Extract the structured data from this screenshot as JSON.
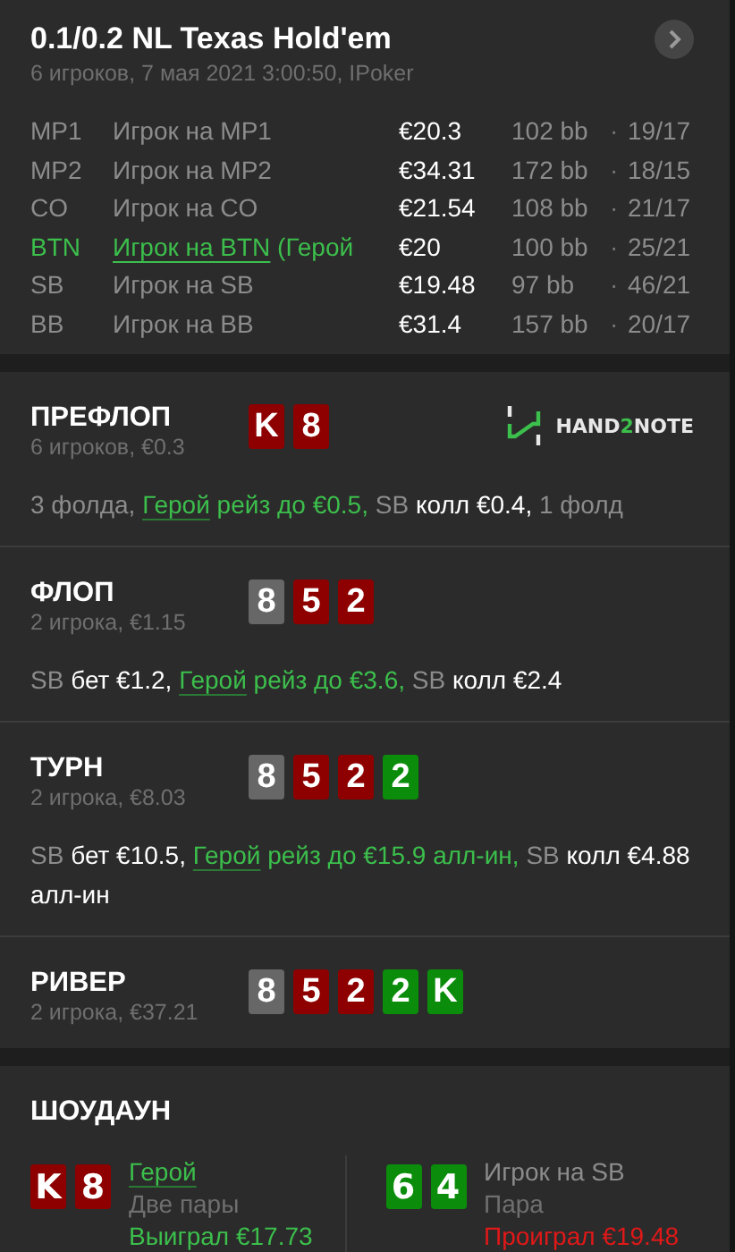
{
  "header": {
    "title": "0.1/0.2 NL Texas Hold'em",
    "subtitle": "6 игроков, 7 мая 2021 3:00:50, IPoker",
    "players": [
      {
        "position": "MP1",
        "name": "Игрок на MP1",
        "stack": "€20.3",
        "bb": "102 bb",
        "stats": "19/17",
        "hero": false
      },
      {
        "position": "MP2",
        "name": "Игрок на MP2",
        "stack": "€34.31",
        "bb": "172 bb",
        "stats": "18/15",
        "hero": false
      },
      {
        "position": "CO",
        "name": "Игрок на CO",
        "stack": "€21.54",
        "bb": "108 bb",
        "stats": "21/17",
        "hero": false
      },
      {
        "position": "BTN",
        "name": "Игрок на BTN",
        "note": "(Герой",
        "stack": "€20",
        "bb": "100 bb",
        "stats": "25/21",
        "hero": true
      },
      {
        "position": "SB",
        "name": "Игрок на SB",
        "stack": "€19.48",
        "bb": "97 bb",
        "stats": "46/21",
        "hero": false
      },
      {
        "position": "BB",
        "name": "Игрок на BB",
        "stack": "€31.4",
        "bb": "157 bb",
        "stats": "20/17",
        "hero": false
      }
    ],
    "separator": "·"
  },
  "streets": [
    {
      "title": "ПРЕФЛОП",
      "subtitle": "6 игроков, €0.3",
      "cards": [
        {
          "rank": "K",
          "color": "#8e0000"
        },
        {
          "rank": "8",
          "color": "#8e0000"
        }
      ],
      "logo": {
        "before": "HAND",
        "accent": "2",
        "after": "NOTE"
      },
      "actions": [
        {
          "text": "3 фолда, ",
          "kind": "muted"
        },
        {
          "text": "Герой",
          "kind": "hero-link"
        },
        {
          "text": " рейз до €0.5, ",
          "kind": "hero"
        },
        {
          "text": "SB",
          "kind": "muted"
        },
        {
          "text": " колл €0.4, ",
          "kind": "plain"
        },
        {
          "text": "1 фолд",
          "kind": "muted"
        }
      ]
    },
    {
      "title": "ФЛОП",
      "subtitle": "2 игрока, €1.15",
      "cards": [
        {
          "rank": "8",
          "color": "#676767"
        },
        {
          "rank": "5",
          "color": "#8e0000"
        },
        {
          "rank": "2",
          "color": "#8e0000"
        }
      ],
      "actions": [
        {
          "text": "SB",
          "kind": "muted"
        },
        {
          "text": " бет €1.2, ",
          "kind": "plain"
        },
        {
          "text": "Герой",
          "kind": "hero-link"
        },
        {
          "text": " рейз до €3.6, ",
          "kind": "hero"
        },
        {
          "text": "SB",
          "kind": "muted"
        },
        {
          "text": " колл €2.4",
          "kind": "plain"
        }
      ]
    },
    {
      "title": "ТУРН",
      "subtitle": "2 игрока, €8.03",
      "cards": [
        {
          "rank": "8",
          "color": "#676767"
        },
        {
          "rank": "5",
          "color": "#8e0000"
        },
        {
          "rank": "2",
          "color": "#8e0000"
        },
        {
          "rank": "2",
          "color": "#0b8d0b"
        }
      ],
      "actions": [
        {
          "text": "SB",
          "kind": "muted"
        },
        {
          "text": " бет €10.5, ",
          "kind": "plain"
        },
        {
          "text": "Герой",
          "kind": "hero-link"
        },
        {
          "text": " рейз до €15.9 алл-ин, ",
          "kind": "hero"
        },
        {
          "text": "SB",
          "kind": "muted"
        },
        {
          "text": " колл €4.88 алл-ин",
          "kind": "plain"
        }
      ]
    },
    {
      "title": "РИВЕР",
      "subtitle": "2 игрока, €37.21",
      "cards": [
        {
          "rank": "8",
          "color": "#676767"
        },
        {
          "rank": "5",
          "color": "#8e0000"
        },
        {
          "rank": "2",
          "color": "#8e0000"
        },
        {
          "rank": "2",
          "color": "#0b8d0b"
        },
        {
          "rank": "K",
          "color": "#0b8d0b"
        }
      ]
    }
  ],
  "showdown": {
    "title": "ШОУДАУН",
    "players": [
      {
        "name": "Герой",
        "hero": true,
        "hand": "Две пары",
        "result": "Выиграл €17.73",
        "won": true,
        "cards": [
          {
            "rank": "K",
            "color": "#8e0000"
          },
          {
            "rank": "8",
            "color": "#8e0000"
          }
        ]
      },
      {
        "name": "Игрок на SB",
        "hero": false,
        "hand": "Пара",
        "result": "Проиграл €19.48",
        "won": false,
        "cards": [
          {
            "rank": "6",
            "color": "#0b8d0b"
          },
          {
            "rank": "4",
            "color": "#0b8d0b"
          }
        ]
      }
    ]
  }
}
